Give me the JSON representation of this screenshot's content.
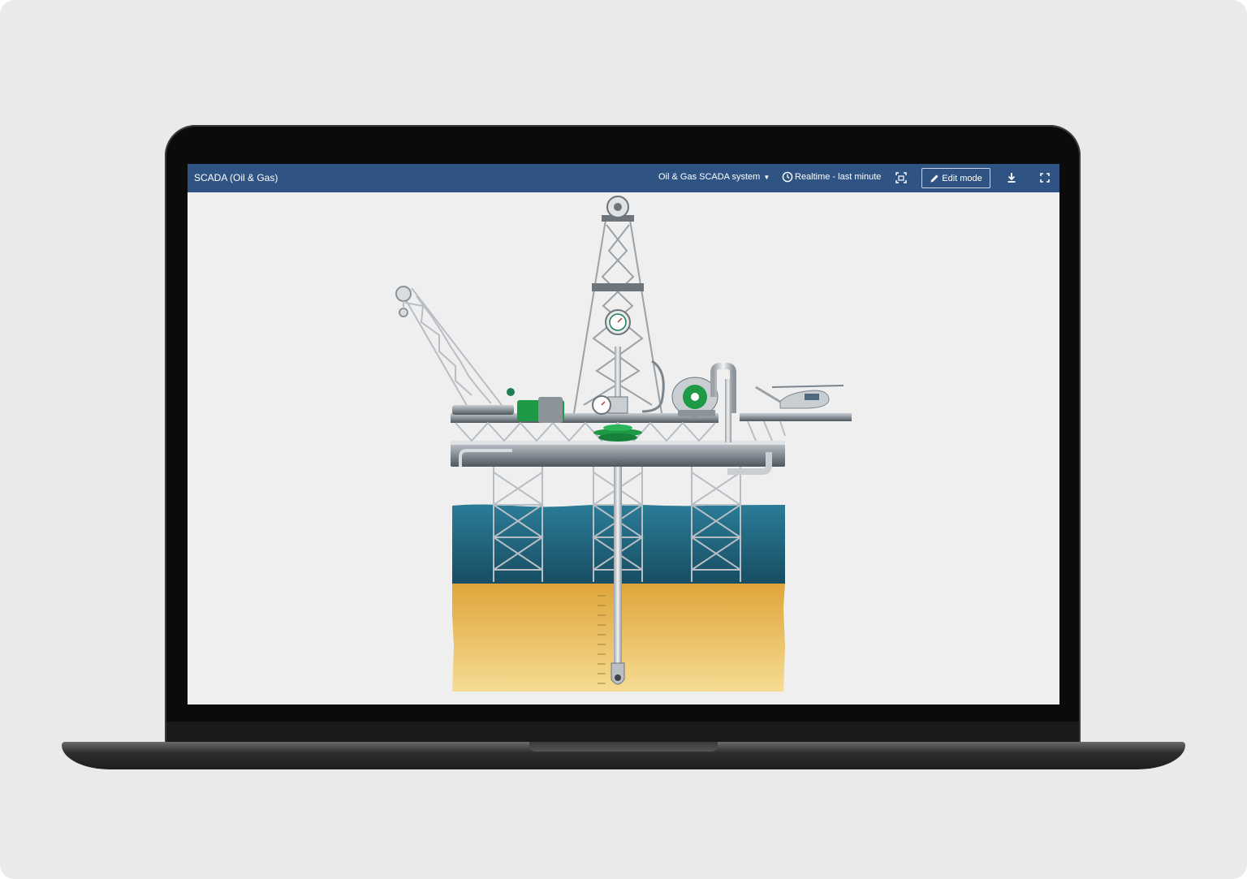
{
  "header": {
    "app_title": "SCADA (Oil & Gas)",
    "dashboard_select": "Oil & Gas SCADA system",
    "time_window": "Realtime - last minute",
    "edit_mode_label": "Edit mode"
  },
  "icons": {
    "dropdown": "caret-down-icon",
    "time_window": "clock-icon",
    "entity_view": "fit-screen-icon",
    "edit": "pencil-icon",
    "download": "download-icon",
    "fullscreen": "fullscreen-icon"
  },
  "colors": {
    "header_bg": "#2f5483",
    "sea_top": "#1e6f8f",
    "sea_bottom": "#164e66",
    "seabed_top": "#e0a93a",
    "seabed_bottom": "#f5d98b",
    "equipment_green": "#1e9a46"
  }
}
